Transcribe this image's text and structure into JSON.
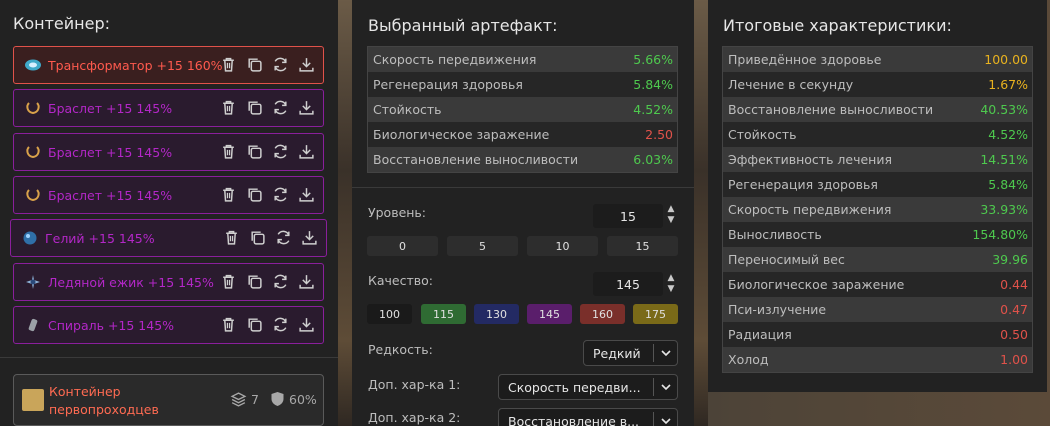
{
  "container": {
    "title": "Контейнер:",
    "slots": [
      {
        "label": "Трансформатор +15 160%",
        "icon": "transformer-artifact-icon",
        "active": true
      },
      {
        "label": "Браслет +15 145%",
        "icon": "bracelet-artifact-icon"
      },
      {
        "label": "Браслет +15 145%",
        "icon": "bracelet-artifact-icon"
      },
      {
        "label": "Браслет +15 145%",
        "icon": "bracelet-artifact-icon"
      },
      {
        "label": "Гелий +15 145%",
        "icon": "helium-artifact-icon"
      },
      {
        "label": "Ледяной ежик +15 145%",
        "icon": "ice-hedgehog-artifact-icon"
      },
      {
        "label": "Спираль +15 145%",
        "icon": "spiral-artifact-icon"
      }
    ],
    "card": {
      "name": "Контейнер первопроходцев",
      "slots_count": "7",
      "protection": "60%"
    }
  },
  "selected": {
    "title": "Выбранный артефакт:",
    "stats": [
      {
        "name": "Скорость передвижения",
        "value": "5.66%",
        "tone": "g"
      },
      {
        "name": "Регенерация здоровья",
        "value": "5.84%",
        "tone": "g"
      },
      {
        "name": "Стойкость",
        "value": "4.52%",
        "tone": "g"
      },
      {
        "name": "Биологическое заражение",
        "value": "2.50",
        "tone": "r"
      },
      {
        "name": "Восстановление выносливости",
        "value": "6.03%",
        "tone": "g"
      }
    ],
    "level": {
      "label": "Уровень:",
      "value": "15",
      "quick": [
        "0",
        "5",
        "10",
        "15"
      ]
    },
    "quality": {
      "label": "Качество:",
      "value": "145",
      "quick": [
        {
          "v": "100",
          "color": "#1a1a1a"
        },
        {
          "v": "115",
          "color": "#2f6b33"
        },
        {
          "v": "130",
          "color": "#232a63"
        },
        {
          "v": "145",
          "color": "#5a1e6b"
        },
        {
          "v": "160",
          "color": "#7a2f2a"
        },
        {
          "v": "175",
          "color": "#7a6a18"
        }
      ]
    },
    "rarity": {
      "label": "Редкость:",
      "value": "Редкий"
    },
    "extra1": {
      "label": "Доп. хар-ка 1:",
      "value": "Скорость передви..."
    },
    "extra2": {
      "label": "Доп. хар-ка 2:",
      "value": "Восстановление в..."
    }
  },
  "totals": {
    "title": "Итоговые характеристики:",
    "stats": [
      {
        "name": "Приведённое здоровье",
        "value": "100.00",
        "tone": "y"
      },
      {
        "name": "Лечение в секунду",
        "value": "1.67%",
        "tone": "y"
      },
      {
        "name": "Восстановление выносливости",
        "value": "40.53%",
        "tone": "g"
      },
      {
        "name": "Стойкость",
        "value": "4.52%",
        "tone": "g"
      },
      {
        "name": "Эффективность лечения",
        "value": "14.51%",
        "tone": "g"
      },
      {
        "name": "Регенерация здоровья",
        "value": "5.84%",
        "tone": "g"
      },
      {
        "name": "Скорость передвижения",
        "value": "33.93%",
        "tone": "g"
      },
      {
        "name": "Выносливость",
        "value": "154.80%",
        "tone": "g"
      },
      {
        "name": "Переносимый вес",
        "value": "39.96",
        "tone": "g"
      },
      {
        "name": "Биологическое заражение",
        "value": "0.44",
        "tone": "r"
      },
      {
        "name": "Пси-излучение",
        "value": "0.47",
        "tone": "r"
      },
      {
        "name": "Радиация",
        "value": "0.50",
        "tone": "r"
      },
      {
        "name": "Холод",
        "value": "1.00",
        "tone": "r"
      }
    ]
  }
}
